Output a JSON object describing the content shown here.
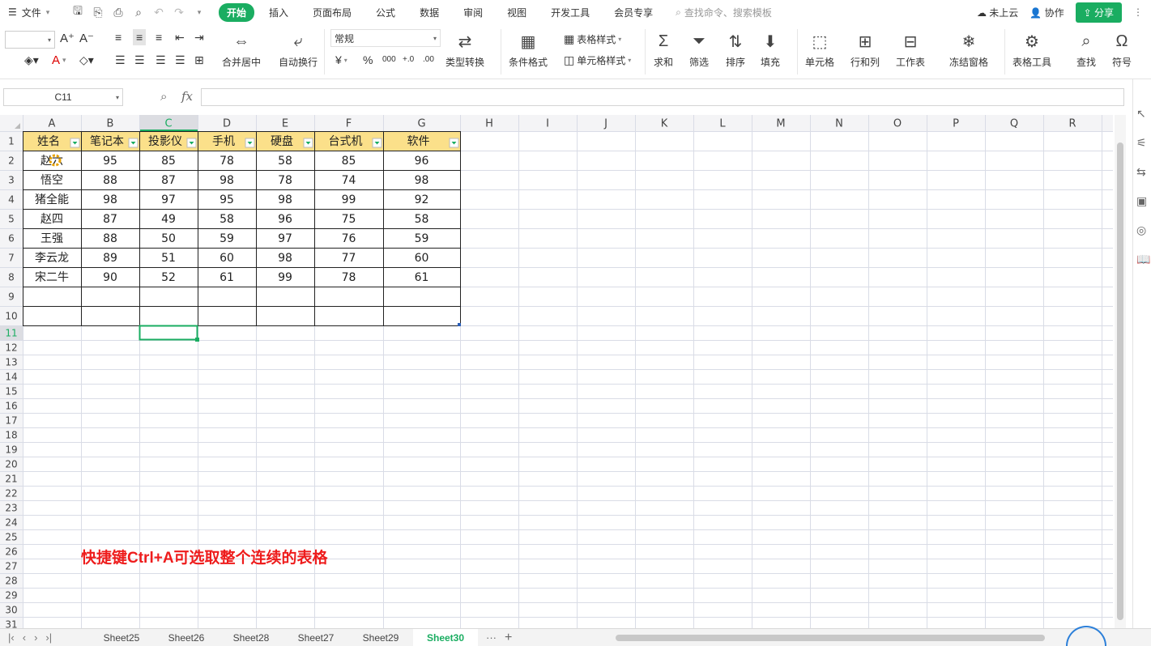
{
  "menubar": {
    "file_label": "文件",
    "tabs": [
      "开始",
      "插入",
      "页面布局",
      "公式",
      "数据",
      "审阅",
      "视图",
      "开发工具",
      "会员专享"
    ],
    "active_tab": "开始",
    "search_placeholder": "查找命令、搜索模板",
    "cloud_label": "未上云",
    "collab_label": "协作",
    "share_label": "分享"
  },
  "ribbon": {
    "merge_center": "合并居中",
    "auto_wrap": "自动换行",
    "number_format": "常规",
    "currency": "¥",
    "percent": "%",
    "thousands": "000",
    "type_convert": "类型转换",
    "cond_format": "条件格式",
    "table_style": "表格样式",
    "cell_style": "单元格样式",
    "sum": "求和",
    "filter": "筛选",
    "sort": "排序",
    "fill": "填充",
    "cell": "单元格",
    "row_col": "行和列",
    "worksheet": "工作表",
    "freeze": "冻结窗格",
    "table_tools": "表格工具",
    "find": "查找",
    "symbol": "符号"
  },
  "formula_bar": {
    "cell_ref": "C11",
    "fx": "fx",
    "content": ""
  },
  "sheet": {
    "columns": [
      "A",
      "B",
      "C",
      "D",
      "E",
      "F",
      "G",
      "H",
      "I",
      "J",
      "K",
      "L",
      "M",
      "N",
      "O",
      "P",
      "Q",
      "R"
    ],
    "rows": [
      "1",
      "2",
      "3",
      "4",
      "5",
      "6",
      "7",
      "8",
      "9",
      "10",
      "11",
      "12",
      "13",
      "14",
      "15",
      "16",
      "17",
      "18",
      "19",
      "20",
      "21",
      "22",
      "23",
      "24",
      "25",
      "26",
      "27",
      "28",
      "29",
      "30",
      "31"
    ],
    "active_column": "C",
    "active_row": "11",
    "headers": [
      "姓名",
      "笔记本",
      "投影仪",
      "手机",
      "硬盘",
      "台式机",
      "软件"
    ],
    "data": [
      [
        "赵六",
        "95",
        "85",
        "78",
        "58",
        "85",
        "96"
      ],
      [
        "悟空",
        "88",
        "87",
        "98",
        "78",
        "74",
        "98"
      ],
      [
        "猪全能",
        "98",
        "97",
        "95",
        "98",
        "99",
        "92"
      ],
      [
        "赵四",
        "87",
        "49",
        "58",
        "96",
        "75",
        "58"
      ],
      [
        "王强",
        "88",
        "50",
        "59",
        "97",
        "76",
        "59"
      ],
      [
        "李云龙",
        "89",
        "51",
        "60",
        "98",
        "77",
        "60"
      ],
      [
        "宋二牛",
        "90",
        "52",
        "61",
        "99",
        "78",
        "61"
      ]
    ],
    "header_color": "#fbe08a",
    "annotation": "快捷键Ctrl+A可选取整个连续的表格",
    "annotation_color": "#ee1c1c"
  },
  "sheet_tabs": {
    "tabs": [
      "Sheet25",
      "Sheet26",
      "Sheet28",
      "Sheet27",
      "Sheet29",
      "Sheet30"
    ],
    "active": "Sheet30",
    "more": "···",
    "add": "+"
  },
  "colors": {
    "accent": "#1aad61",
    "grid_line": "#d9dce6",
    "selection": "#1aad61"
  }
}
